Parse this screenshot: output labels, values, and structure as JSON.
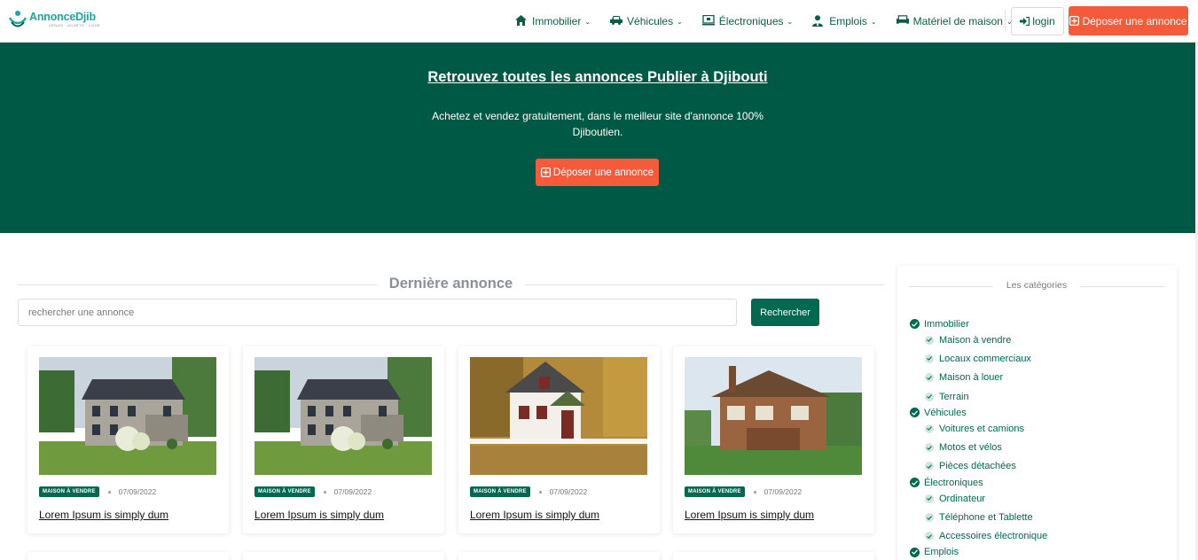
{
  "logo": {
    "name": "AnnonceDjib",
    "tagline": "VENDS · ACHÈTE · LOUE"
  },
  "nav": {
    "items": [
      {
        "label": "Immobilier",
        "icon": "home-icon"
      },
      {
        "label": "Véhicules",
        "icon": "car-icon"
      },
      {
        "label": "Électroniques",
        "icon": "laptop-icon"
      },
      {
        "label": "Emplois",
        "icon": "user-tie-icon"
      },
      {
        "label": "Matériel de maison",
        "icon": "couch-icon"
      }
    ],
    "login_label": "login",
    "post_label": "Déposer une annonce"
  },
  "hero": {
    "title": "Retrouvez toutes les annonces Publier à Djibouti",
    "subtitle": "Achetez et vendez gratuitement, dans le meilleur site d'annonce 100% Djiboutien.",
    "button_label": "Déposer une annonce"
  },
  "main": {
    "section_title": "Dernière annonce",
    "search_placeholder": "rechercher une annonce",
    "search_button": "Rechercher",
    "listings": [
      {
        "badge": "MAISON À VENDRE",
        "date": "07/09/2022",
        "title": "Lorem Ipsum is simply dum"
      },
      {
        "badge": "MAISON À VENDRE",
        "date": "07/09/2022",
        "title": "Lorem Ipsum is simply dum"
      },
      {
        "badge": "MAISON À VENDRE",
        "date": "07/09/2022",
        "title": "Lorem Ipsum is simply dum"
      },
      {
        "badge": "MAISON À VENDRE",
        "date": "07/09/2022",
        "title": "Lorem Ipsum is simply dum"
      }
    ]
  },
  "sidebar": {
    "title": "Les catégories",
    "categories": [
      {
        "label": "Immobilier",
        "subs": [
          "Maison à vendre",
          "Locaux commerciaux",
          "Maison à louer",
          "Terrain"
        ]
      },
      {
        "label": "Véhicules",
        "subs": [
          "Voitures et camions",
          "Motos et vélos",
          "Pièces détachées"
        ]
      },
      {
        "label": "Électroniques",
        "subs": [
          "Ordinateur",
          "Téléphone et Tablette",
          "Accessoires électronique"
        ]
      },
      {
        "label": "Emplois",
        "subs": []
      }
    ]
  },
  "colors": {
    "brand_green": "#005944",
    "accent_orange": "#f55b3b",
    "dark_green": "#00694f"
  }
}
